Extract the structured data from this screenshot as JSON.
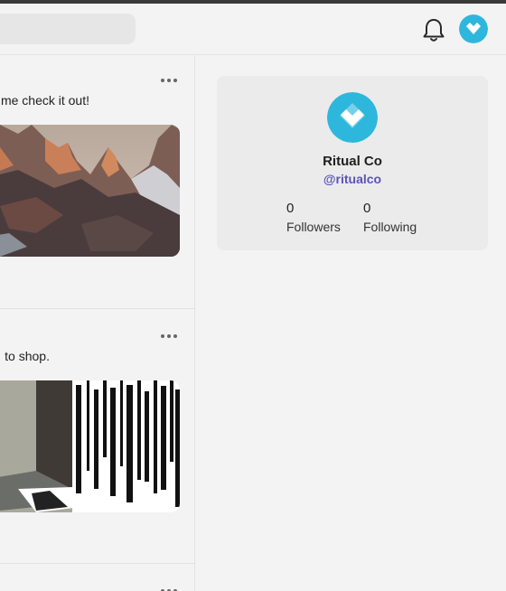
{
  "app": {
    "colors": {
      "accent": "#2db7dd",
      "handle": "#5a54b8"
    }
  },
  "header": {
    "search_icon": "none",
    "notifications_icon": "bell-icon",
    "avatar_icon": "ritual-heart-logo"
  },
  "feed": {
    "posts": [
      {
        "text": "me check it out!",
        "menu_icon": "more-horizontal-icon",
        "image": "mountain-peaks"
      },
      {
        "text": "to shop.",
        "menu_icon": "more-horizontal-icon",
        "image": "street-scene"
      },
      {
        "text": "",
        "menu_icon": "more-horizontal-icon"
      }
    ]
  },
  "profile": {
    "name": "Ritual Co",
    "handle": "@ritualco",
    "followers_count": "0",
    "followers_label": "Followers",
    "following_count": "0",
    "following_label": "Following"
  }
}
